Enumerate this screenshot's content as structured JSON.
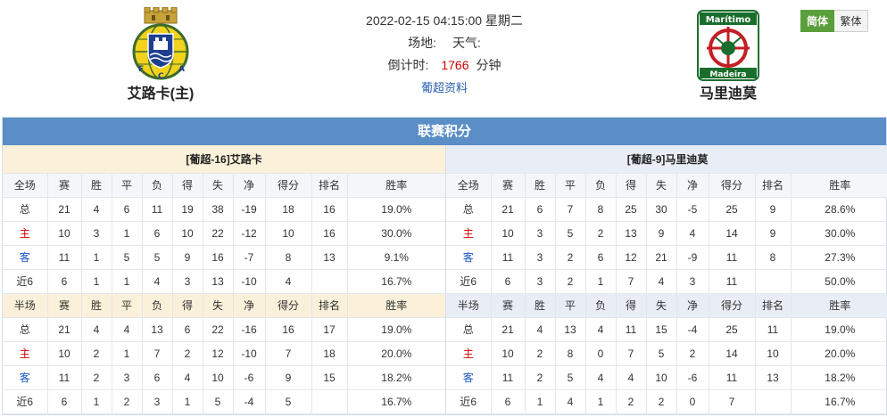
{
  "match": {
    "datetime": "2022-02-15 04:15:00 星期二",
    "venue_label": "场地:",
    "weather_label": "天气:",
    "countdown_label": "倒计时:",
    "countdown_value": "1766",
    "countdown_unit": "分钟",
    "league_link": "葡超资料"
  },
  "home_team": {
    "name": "艾路卡(主)",
    "logo_icon": "arouca-crest-icon"
  },
  "away_team": {
    "name": "马里迪莫",
    "logo_icon": "maritimo-crest-icon",
    "logo_text_top": "Marítimo",
    "logo_text_bottom": "Madeira"
  },
  "lang": {
    "simplified": "简体",
    "traditional": "繁体"
  },
  "colors": {
    "header_bar": "#5b8ec7",
    "home_panel": "#fbf0d9",
    "away_panel": "#e9eef6",
    "home_row": "#d00000",
    "away_row": "#1a56c8",
    "active_lang": "#5a9f3b"
  },
  "standings": {
    "title": "联赛积分",
    "panels": [
      {
        "title": "[葡超-16]艾路卡",
        "full": {
          "headers": [
            "全场",
            "赛",
            "胜",
            "平",
            "负",
            "得",
            "失",
            "净",
            "得分",
            "排名",
            "胜率"
          ],
          "rows": [
            [
              "总",
              "21",
              "4",
              "6",
              "11",
              "19",
              "38",
              "-19",
              "18",
              "16",
              "19.0%"
            ],
            [
              "主",
              "10",
              "3",
              "1",
              "6",
              "10",
              "22",
              "-12",
              "10",
              "16",
              "30.0%"
            ],
            [
              "客",
              "11",
              "1",
              "5",
              "5",
              "9",
              "16",
              "-7",
              "8",
              "13",
              "9.1%"
            ],
            [
              "近6",
              "6",
              "1",
              "1",
              "4",
              "3",
              "13",
              "-10",
              "4",
              "",
              "16.7%"
            ]
          ]
        },
        "half": {
          "headers": [
            "半场",
            "赛",
            "胜",
            "平",
            "负",
            "得",
            "失",
            "净",
            "得分",
            "排名",
            "胜率"
          ],
          "rows": [
            [
              "总",
              "21",
              "4",
              "4",
              "13",
              "6",
              "22",
              "-16",
              "16",
              "17",
              "19.0%"
            ],
            [
              "主",
              "10",
              "2",
              "1",
              "7",
              "2",
              "12",
              "-10",
              "7",
              "18",
              "20.0%"
            ],
            [
              "客",
              "11",
              "2",
              "3",
              "6",
              "4",
              "10",
              "-6",
              "9",
              "15",
              "18.2%"
            ],
            [
              "近6",
              "6",
              "1",
              "2",
              "3",
              "1",
              "5",
              "-4",
              "5",
              "",
              "16.7%"
            ]
          ]
        }
      },
      {
        "title": "[葡超-9]马里迪莫",
        "full": {
          "headers": [
            "全场",
            "赛",
            "胜",
            "平",
            "负",
            "得",
            "失",
            "净",
            "得分",
            "排名",
            "胜率"
          ],
          "rows": [
            [
              "总",
              "21",
              "6",
              "7",
              "8",
              "25",
              "30",
              "-5",
              "25",
              "9",
              "28.6%"
            ],
            [
              "主",
              "10",
              "3",
              "5",
              "2",
              "13",
              "9",
              "4",
              "14",
              "9",
              "30.0%"
            ],
            [
              "客",
              "11",
              "3",
              "2",
              "6",
              "12",
              "21",
              "-9",
              "11",
              "8",
              "27.3%"
            ],
            [
              "近6",
              "6",
              "3",
              "2",
              "1",
              "7",
              "4",
              "3",
              "11",
              "",
              "50.0%"
            ]
          ]
        },
        "half": {
          "headers": [
            "半场",
            "赛",
            "胜",
            "平",
            "负",
            "得",
            "失",
            "净",
            "得分",
            "排名",
            "胜率"
          ],
          "rows": [
            [
              "总",
              "21",
              "4",
              "13",
              "4",
              "11",
              "15",
              "-4",
              "25",
              "11",
              "19.0%"
            ],
            [
              "主",
              "10",
              "2",
              "8",
              "0",
              "7",
              "5",
              "2",
              "14",
              "10",
              "20.0%"
            ],
            [
              "客",
              "11",
              "2",
              "5",
              "4",
              "4",
              "10",
              "-6",
              "11",
              "13",
              "18.2%"
            ],
            [
              "近6",
              "6",
              "1",
              "4",
              "1",
              "2",
              "2",
              "0",
              "7",
              "",
              "16.7%"
            ]
          ]
        }
      }
    ]
  }
}
